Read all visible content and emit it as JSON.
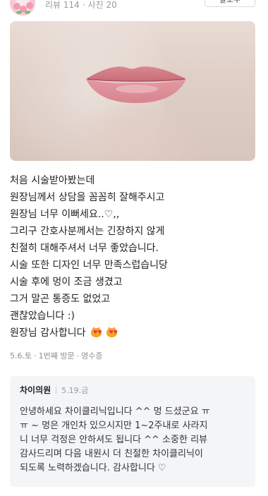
{
  "header": {
    "meta_reviews": "리뷰 114",
    "meta_separator": "·",
    "meta_photos": "사진 20",
    "follow_label": "팔로우"
  },
  "review": {
    "photo_icon": "lips-photo",
    "lines": [
      "처음 시술받아봤는데",
      "원장님께서 상담을 꼼꼼히 잘해주시고",
      "원장님 너무 이뻐세요..♡,,",
      "그리구 간호사분께서는 긴장하지 않게",
      "친절히 대해주셔서 너무 좋았습니다.",
      "시술 또한 디자인 너무 만족스럽습니당",
      "시술 후에 멍이 조금 생겼고",
      "그거 말곤 통증도 없었고",
      "괜찮았습니다 :)",
      "원장님 감사합니다"
    ],
    "emoji_icon": "heart-eyes-cat-icon",
    "visit_date": "5.6.토",
    "visit_count": "1번째 방문",
    "receipt": "영수증",
    "meta_dot": "·"
  },
  "reply": {
    "owner": "차이의원",
    "date": "5.19.금",
    "lines": [
      "안녕하세요 차이클리닉입니다 ^^ 멍 드셨군요 ㅠ",
      "ㅠ ~ 멍은 개인차 있으시지만 1~2주내로 사라지",
      "니 너무 걱정은 안하셔도 됩니다 ^^ 소중한 리뷰",
      "감사드리며 다음 내원시 더 친절한 차이클리닉이",
      "되도록 노력하겠습니다. 감사합니다 ♡"
    ]
  },
  "colors": {
    "lip": "#e9919a",
    "muted_text": "#9a9a9a",
    "reply_bg": "#f4f5f7"
  }
}
